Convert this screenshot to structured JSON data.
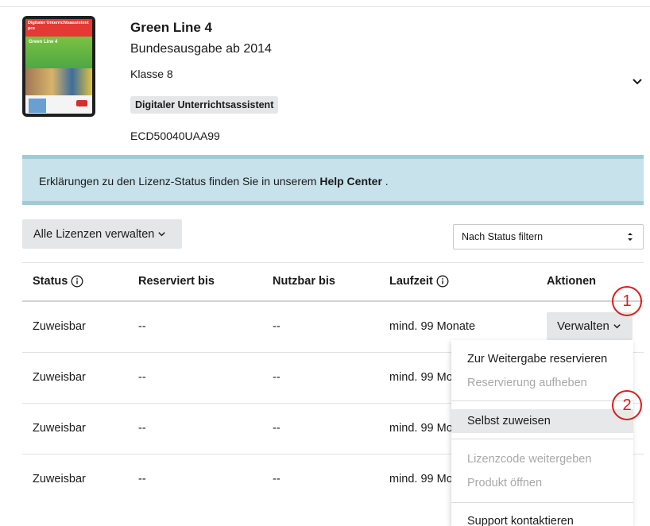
{
  "product": {
    "cover_band_text": "Digitaler Unterrichtsassistent pro",
    "cover_title": "Green Line 4",
    "title": "Green Line 4",
    "subtitle": "Bundesausgabe ab 2014",
    "class": "Klasse 8",
    "badge": "Digitaler Unterrichtsassistent",
    "code": "ECD50040UAA99",
    "expand_icon": "chevron-down-icon"
  },
  "banner": {
    "text_before": "Erklärungen zu den Lizenz-Status finden Sie in unserem ",
    "link": "Help Center",
    "text_after": " ."
  },
  "toolbar": {
    "manage_all_label": "Alle Lizenzen verwalten",
    "filter_value": "Nach Status filtern"
  },
  "table": {
    "headers": {
      "status": "Status",
      "reserved": "Reserviert bis",
      "usable": "Nutzbar bis",
      "runtime": "Laufzeit",
      "actions": "Aktionen"
    },
    "rows": [
      {
        "status": "Zuweisbar",
        "reserved": "--",
        "usable": "--",
        "runtime": "mind. 99 Monate"
      },
      {
        "status": "Zuweisbar",
        "reserved": "--",
        "usable": "--",
        "runtime": "mind. 99 Mo"
      },
      {
        "status": "Zuweisbar",
        "reserved": "--",
        "usable": "--",
        "runtime": "mind. 99 Mo"
      },
      {
        "status": "Zuweisbar",
        "reserved": "--",
        "usable": "--",
        "runtime": "mind. 99 Mo"
      }
    ],
    "manage_label": "Verwalten"
  },
  "menu": {
    "items": [
      {
        "label": "Zur Weitergabe reservieren",
        "disabled": false
      },
      {
        "label": "Reservierung aufheben",
        "disabled": true
      },
      {
        "label": "Selbst zuweisen",
        "disabled": false,
        "active": true
      },
      {
        "label": "Lizenzcode weitergeben",
        "disabled": true
      },
      {
        "label": "Produkt öffnen",
        "disabled": true
      },
      {
        "label": "Support kontaktieren",
        "disabled": false
      }
    ]
  },
  "annotations": [
    "1",
    "2"
  ],
  "colors": {
    "banner_bg": "#c7e2ea",
    "button_bg": "#e4e6e8",
    "annotation": "#e01b1b",
    "disabled_text": "#a8a8a8"
  }
}
